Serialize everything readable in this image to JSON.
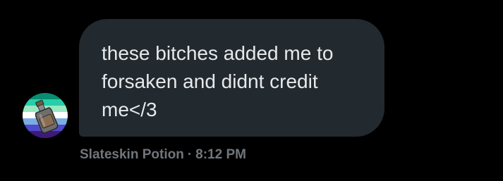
{
  "message": {
    "text": "these bitches added me to forsaken and didnt credit me</3",
    "sender": "Slateskin Potion",
    "separator": "·",
    "time": "8:12 PM"
  },
  "avatar": {
    "icon": "potion-bottle-icon",
    "flag_colors": [
      "#078d70",
      "#26ceaa",
      "#98e8c1",
      "#ffffff",
      "#7bade2",
      "#5049cc",
      "#3d1a78"
    ]
  },
  "colors": {
    "background": "#000000",
    "bubble": "#22292f",
    "message_text": "#e7e9ea",
    "meta_text": "#71767b"
  }
}
